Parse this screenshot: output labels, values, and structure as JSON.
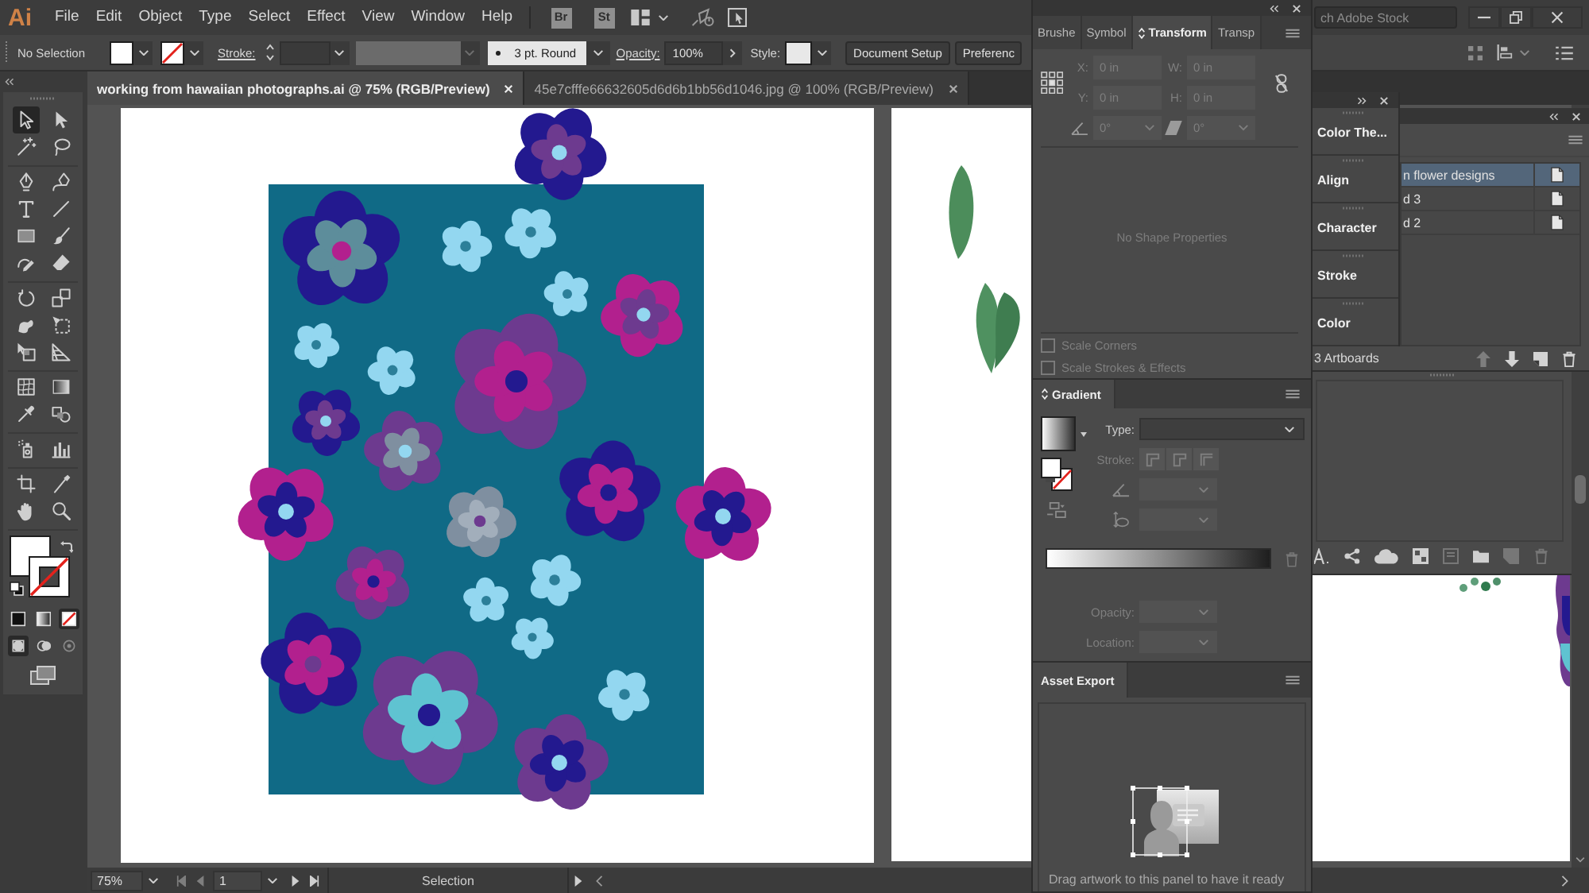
{
  "menu_bar": {
    "logo": "Ai",
    "items": [
      "File",
      "Edit",
      "Object",
      "Type",
      "Select",
      "Effect",
      "View",
      "Window",
      "Help"
    ],
    "app_buttons": [
      "Br",
      "St"
    ],
    "search": {
      "placeholder": "ch Adobe Stock"
    }
  },
  "control_bar": {
    "selection": "No Selection",
    "stroke_label": "Stroke:",
    "brush": "3 pt. Round",
    "opacity_label": "Opacity:",
    "opacity": "100%",
    "style_label": "Style:",
    "buttons": [
      "Document Setup",
      "Preferenc"
    ]
  },
  "document_tabs": [
    {
      "title": "working from hawaiian photographs.ai @ 75% (RGB/Preview)",
      "selected": true
    },
    {
      "title": "45e7cfffe66632605d6d6b1bb56d1046.jpg @ 100% (RGB/Preview)",
      "selected": false
    }
  ],
  "toolbar": {
    "tools": [
      {
        "selected": true
      },
      {
        "selected": false
      },
      {
        "selected": false
      },
      {
        "selected": false
      },
      {
        "selected": false
      },
      {
        "selected": false
      },
      {
        "selected": false
      },
      {
        "selected": false
      },
      {
        "selected": false
      },
      {
        "selected": false
      },
      {
        "selected": false
      },
      {
        "selected": false
      },
      {
        "selected": false
      },
      {
        "selected": false
      },
      {
        "selected": false
      },
      {
        "selected": false
      },
      {
        "selected": false
      },
      {
        "selected": false
      },
      {
        "selected": false
      },
      {
        "selected": false
      },
      {
        "selected": false
      },
      {
        "selected": false
      },
      {
        "selected": false
      },
      {
        "selected": false
      },
      {
        "selected": false
      },
      {
        "selected": false
      },
      {
        "selected": false
      },
      {
        "selected": false
      }
    ],
    "color_modes": [
      {
        "selected": false
      },
      {
        "selected": false
      },
      {
        "selected": true
      }
    ],
    "draw_modes": [
      {
        "selected": true
      },
      {
        "selected": false
      },
      {
        "selected": false
      }
    ]
  },
  "transform_panel": {
    "tabs": [
      {
        "label": "Brushe",
        "selected": false
      },
      {
        "label": "Symbol",
        "selected": false
      },
      {
        "label": "Transform",
        "selected": true
      },
      {
        "label": "Transp",
        "selected": false
      }
    ],
    "fields": [
      {
        "label": "X:",
        "value": "0 in",
        "disabled": true
      },
      {
        "label": "W:",
        "value": "0 in",
        "disabled": true
      },
      {
        "label": "Y:",
        "value": "0 in",
        "disabled": true
      },
      {
        "label": "H:",
        "value": "0 in",
        "disabled": true
      }
    ],
    "angle": {
      "value": "0°",
      "disabled": true
    },
    "shear": {
      "value": "0°",
      "disabled": true
    },
    "message": "No Shape Properties",
    "options": [
      {
        "label": "Scale Corners",
        "checked": false,
        "disabled": true
      },
      {
        "label": "Scale Strokes & Effects",
        "checked": false,
        "disabled": true
      }
    ]
  },
  "gradient_panel": {
    "title": "Gradient",
    "type": {
      "label": "Type:",
      "disabled": false
    },
    "stroke": {
      "label": "Stroke:",
      "disabled": true
    },
    "angle": {
      "disabled": true
    },
    "aspect": {
      "disabled": true
    },
    "opacity": {
      "label": "Opacity:",
      "disabled": true
    },
    "location": {
      "label": "Location:",
      "disabled": true
    }
  },
  "asset_export_panel": {
    "title": "Asset Export",
    "hint": "Drag artwork to this panel to have it ready"
  },
  "collapsed_panels": [
    "Color The...",
    "Align",
    "Character",
    "Stroke",
    "Color"
  ],
  "artboards_panel": {
    "rows": [
      {
        "name": "n flower designs",
        "selected": true
      },
      {
        "name": "d 3",
        "selected": false
      },
      {
        "name": "d 2",
        "selected": false
      }
    ],
    "count": "3 Artboards",
    "actions": [
      {
        "disabled": true
      },
      {
        "disabled": false
      },
      {
        "disabled": false
      },
      {
        "disabled": false
      }
    ]
  },
  "status_bar": {
    "zoom": "75%",
    "artboard": "1",
    "tool": "Selection",
    "nav": [
      {
        "disabled": true
      },
      {
        "disabled": true
      },
      {
        "disabled": false
      },
      {
        "disabled": false
      }
    ]
  }
}
